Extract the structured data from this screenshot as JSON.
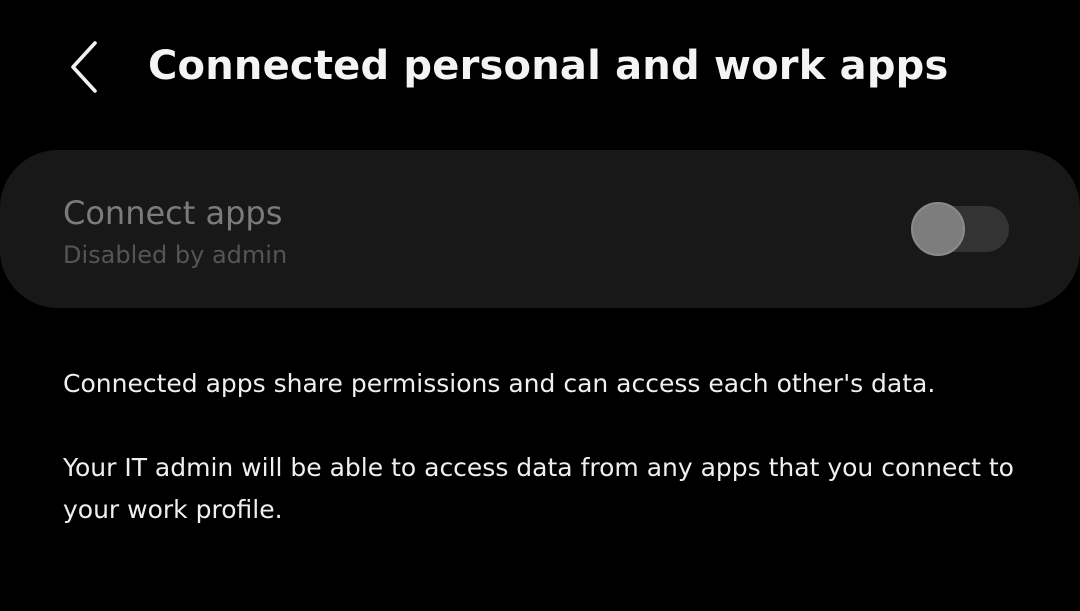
{
  "header": {
    "back_icon": "chevron-left-icon",
    "title": "Connected personal and work apps"
  },
  "setting": {
    "title": "Connect apps",
    "summary": "Disabled by admin",
    "toggle_state": "off",
    "toggle_enabled": false
  },
  "description": {
    "line1": "Connected apps share permissions and can access each other's data.",
    "line2": "Your IT admin will be able to access data from any apps that you connect to your work profile."
  },
  "colors": {
    "background": "#000000",
    "card": "#181818",
    "title_text": "#f4f4f4",
    "disabled_title": "#7b7b7b",
    "disabled_summary": "#555555",
    "toggle_track": "#333333",
    "toggle_thumb": "#7d7d7d"
  }
}
